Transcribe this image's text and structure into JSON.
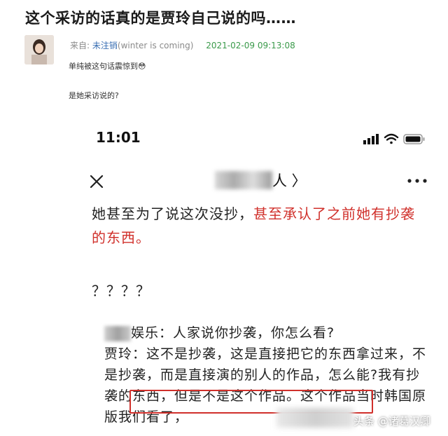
{
  "post": {
    "title": "这个采访的话真的是贾玲自己说的吗……",
    "from_label": "来自:",
    "user": "未注销",
    "user_suffix": "(winter is coming)",
    "date": "2021-02-09 09:13:08",
    "comment1": "单纯被这句话震惊到😳",
    "comment2": "是她采访说的?"
  },
  "phone": {
    "time": "11:01",
    "nav_title_suffix": "人 〉",
    "para1_normal": "她甚至为了说这次没抄，",
    "para1_red": "甚至承认了之前她有抄袭的东西。",
    "para2": "？？？？",
    "qa_line1_rest": "娱乐：人家说你抄袭，你怎么看?",
    "qa_line2": "贾玲：这不是抄袭，这是直接把它的东西拿过来，不是抄袭，而是直接演的别人的作品，怎么能?",
    "qa_boxed": "我有抄袭的东西，但是不是这个作品。",
    "qa_after": "这个作品当时韩国原版我们看了，"
  },
  "watermark": "头条 @诸葛汉卿"
}
